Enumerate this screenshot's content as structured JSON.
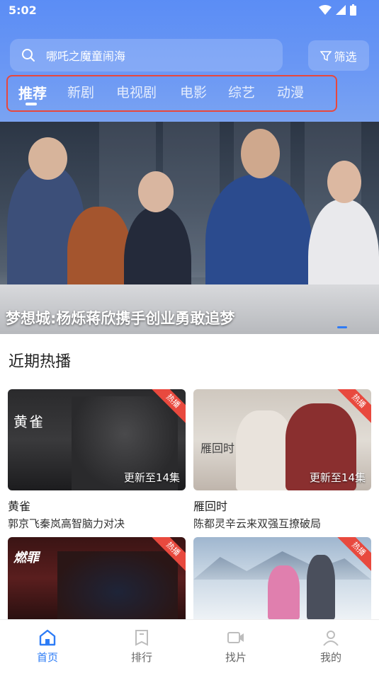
{
  "status_bar": {
    "time": "5:02"
  },
  "search": {
    "placeholder_text": "哪吒之魔童闹海"
  },
  "filter_label": "筛选",
  "tabs": [
    {
      "label": "推荐",
      "active": true
    },
    {
      "label": "新剧",
      "active": false
    },
    {
      "label": "电视剧",
      "active": false
    },
    {
      "label": "电影",
      "active": false
    },
    {
      "label": "综艺",
      "active": false
    },
    {
      "label": "动漫",
      "active": false
    }
  ],
  "banner": {
    "caption": "梦想城:杨烁蒋欣携手创业勇敢追梦"
  },
  "section": {
    "title": "近期热播"
  },
  "cards": [
    {
      "title": "黄雀",
      "subtitle": "郭京飞秦岚高智脑力对决",
      "update": "更新至14集",
      "badge": "热播",
      "poster_text": "黄雀"
    },
    {
      "title": "雁回时",
      "subtitle": "陈都灵辛云来双强互撩破局",
      "update": "更新至14集",
      "badge": "热播",
      "poster_text": "雁回时"
    },
    {
      "badge": "热播",
      "poster_text": "燃罪"
    },
    {
      "badge": "热播"
    }
  ],
  "bottom_nav": [
    {
      "label": "首页",
      "icon": "home-icon",
      "active": true
    },
    {
      "label": "排行",
      "icon": "ranking-icon",
      "active": false
    },
    {
      "label": "找片",
      "icon": "video-icon",
      "active": false
    },
    {
      "label": "我的",
      "icon": "profile-icon",
      "active": false
    }
  ],
  "colors": {
    "accent": "#2d7cf6",
    "header": "#5b8df5",
    "hot": "#e8493e",
    "highlight_box": "#e8473c"
  }
}
